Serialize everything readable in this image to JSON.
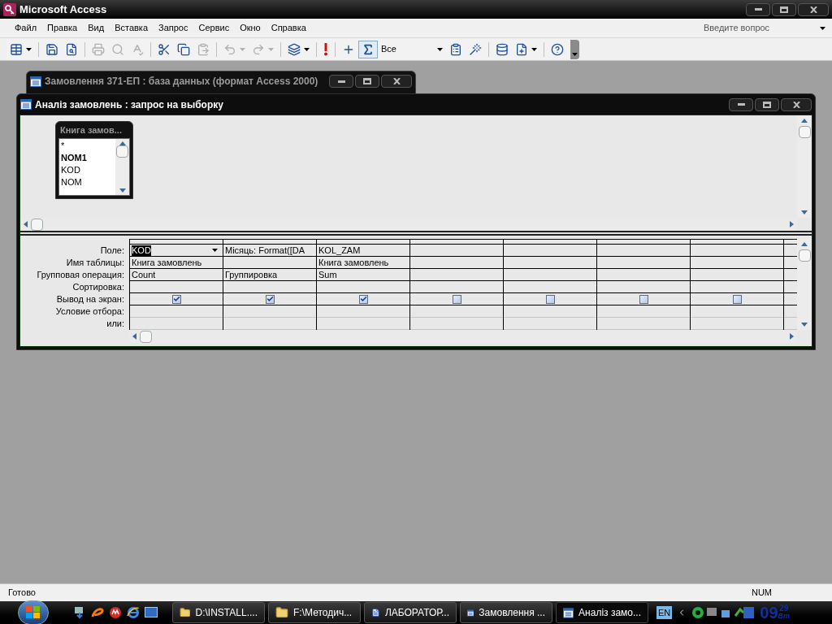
{
  "app_title": "Microsoft Access",
  "menu": [
    "Файл",
    "Правка",
    "Вид",
    "Вставка",
    "Запрос",
    "Сервис",
    "Окно",
    "Справка"
  ],
  "help_box": {
    "placeholder": "Введите вопрос"
  },
  "toolbar": [
    {
      "kind": "view",
      "disabled": false,
      "dropdown": true
    },
    {
      "kind": "save",
      "disabled": false,
      "dropdown": false
    },
    {
      "kind": "search",
      "disabled": false,
      "dropdown": false
    },
    {
      "kind": "print",
      "disabled": true,
      "dropdown": false
    },
    {
      "kind": "preview",
      "disabled": true,
      "dropdown": false
    },
    {
      "kind": "spelling",
      "disabled": true,
      "dropdown": false
    },
    {
      "kind": "cut",
      "disabled": false,
      "dropdown": false
    },
    {
      "kind": "copy",
      "disabled": false,
      "dropdown": false
    },
    {
      "kind": "paste",
      "disabled": true,
      "dropdown": false
    },
    {
      "kind": "undo",
      "disabled": true,
      "dropdown": true
    },
    {
      "kind": "redo",
      "disabled": true,
      "dropdown": true
    },
    {
      "kind": "querytype",
      "disabled": false,
      "dropdown": true
    },
    {
      "kind": "run",
      "disabled": false,
      "dropdown": false
    },
    {
      "kind": "addtable",
      "disabled": false,
      "dropdown": false
    },
    {
      "kind": "totals",
      "disabled": false,
      "dropdown": false,
      "pressed": true
    },
    {
      "kind": "combo",
      "value": "Все"
    },
    {
      "kind": "properties",
      "disabled": false,
      "dropdown": false
    },
    {
      "kind": "build",
      "disabled": false,
      "dropdown": false
    },
    {
      "kind": "dbwindow",
      "disabled": false,
      "dropdown": false
    },
    {
      "kind": "newobject",
      "disabled": false,
      "dropdown": true
    },
    {
      "kind": "help",
      "disabled": false,
      "dropdown": false
    }
  ],
  "db_window": {
    "title": "Замовлення 371-ЕП : база данных (формат Access 2000)"
  },
  "query_window": {
    "title": "Аналіз замовлень : запрос на выборку",
    "table_box": {
      "title": "Книга замов...",
      "fields": [
        {
          "name": "*",
          "key": false
        },
        {
          "name": "NOM1",
          "key": true
        },
        {
          "name": "KOD",
          "key": false
        },
        {
          "name": "NOM",
          "key": false
        }
      ]
    },
    "row_labels": [
      "Поле:",
      "Имя таблицы:",
      "Групповая операция:",
      "Сортировка:",
      "Вывод на экран:",
      "Условие отбора:",
      "или:"
    ],
    "columns": [
      {
        "field": "KOD",
        "active": true,
        "table": "Книга замовлень",
        "total": "Count",
        "show": true
      },
      {
        "field": "Місяць: Format([DA",
        "active": false,
        "total": "Группировка",
        "show": true
      },
      {
        "field": "KOL_ZAM",
        "active": false,
        "table": "Книга замовлень",
        "total": "Sum",
        "show": true
      },
      {
        "show": false
      },
      {
        "show": false
      },
      {
        "show": false
      },
      {
        "show": false
      }
    ]
  },
  "status_bar": {
    "message": "Готово",
    "num": "NUM"
  },
  "taskbar": {
    "items": [
      {
        "label": "D:\\INSTALL....",
        "kind": "folder",
        "selected": false
      },
      {
        "label": "F:\\Методич...",
        "kind": "folder",
        "selected": false
      },
      {
        "label": "ЛАБОРАТОР...",
        "kind": "document",
        "selected": false
      },
      {
        "label": "Замовлення ...",
        "kind": "database",
        "selected": false
      },
      {
        "label": "Аналіз замо...",
        "kind": "query",
        "selected": true
      }
    ],
    "language": "EN",
    "clock_hour": "09",
    "clock_minute": "29",
    "clock_day": "Вт"
  }
}
